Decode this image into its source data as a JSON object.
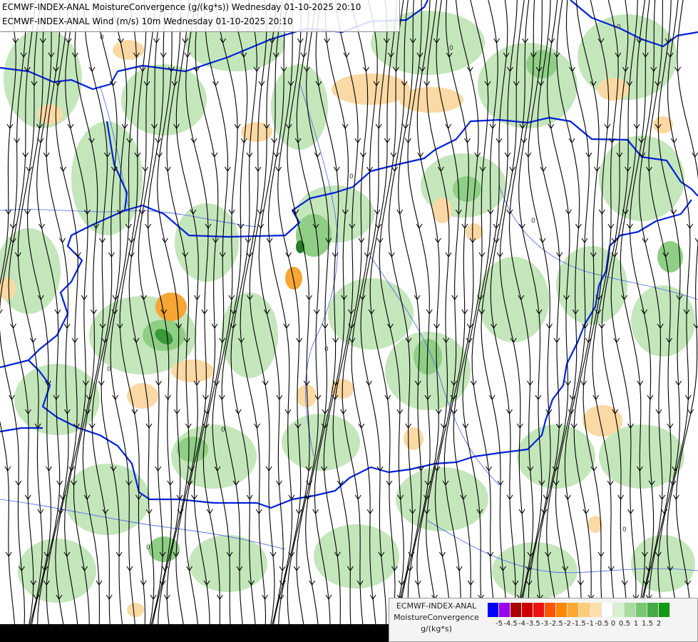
{
  "header": {
    "title_line1": "ECMWF-INDEX-ANAL MoistureConvergence (g/(kg*s)) Wednesday 01-10-2025 20:10",
    "title_line2": "ECMWF-INDEX-ANAL Wind (m/s) 10m Wednesday 01-10-2025 20:10"
  },
  "legend": {
    "line1": "ECMWF-INDEX-ANAL",
    "line2": "MoistureConvergence",
    "line3": "g/(kg*s)",
    "colors": [
      "#0000ff",
      "#9900ee",
      "#aa0000",
      "#cc0000",
      "#ee1111",
      "#ff5500",
      "#ff8800",
      "#ffaa33",
      "#ffcc77",
      "#ffe0aa",
      "#ffffff",
      "#d8f0d0",
      "#aadca0",
      "#77c870",
      "#44aa44",
      "#119911"
    ],
    "tick_labels": [
      "-5",
      "-4.5",
      "-4",
      "-3.5",
      "-3",
      "-2.5",
      "-2",
      "-1.5",
      "-1",
      "-0.5",
      "0",
      "0.5",
      "1",
      "1.5",
      "2"
    ]
  },
  "map_colors": {
    "border": "#0022dd",
    "river": "#4466ee",
    "streamline": "#000000",
    "convergence_light": "#bfe3b6",
    "convergence_medium": "#8fcf85",
    "convergence_strong": "#3a9a3a",
    "divergence_light": "#fbd9a5",
    "divergence_strong": "#f7a535"
  }
}
